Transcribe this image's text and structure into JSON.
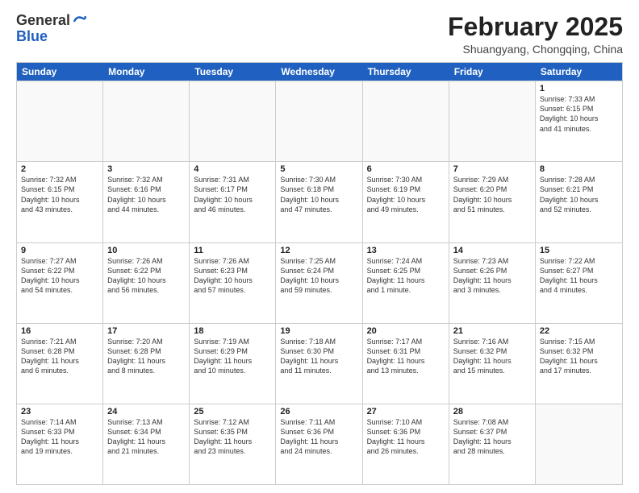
{
  "header": {
    "logo_general": "General",
    "logo_blue": "Blue",
    "month_title": "February 2025",
    "location": "Shuangyang, Chongqing, China"
  },
  "weekdays": [
    "Sunday",
    "Monday",
    "Tuesday",
    "Wednesday",
    "Thursday",
    "Friday",
    "Saturday"
  ],
  "weeks": [
    [
      {
        "day": "",
        "info": ""
      },
      {
        "day": "",
        "info": ""
      },
      {
        "day": "",
        "info": ""
      },
      {
        "day": "",
        "info": ""
      },
      {
        "day": "",
        "info": ""
      },
      {
        "day": "",
        "info": ""
      },
      {
        "day": "1",
        "info": "Sunrise: 7:33 AM\nSunset: 6:15 PM\nDaylight: 10 hours\nand 41 minutes."
      }
    ],
    [
      {
        "day": "2",
        "info": "Sunrise: 7:32 AM\nSunset: 6:15 PM\nDaylight: 10 hours\nand 43 minutes."
      },
      {
        "day": "3",
        "info": "Sunrise: 7:32 AM\nSunset: 6:16 PM\nDaylight: 10 hours\nand 44 minutes."
      },
      {
        "day": "4",
        "info": "Sunrise: 7:31 AM\nSunset: 6:17 PM\nDaylight: 10 hours\nand 46 minutes."
      },
      {
        "day": "5",
        "info": "Sunrise: 7:30 AM\nSunset: 6:18 PM\nDaylight: 10 hours\nand 47 minutes."
      },
      {
        "day": "6",
        "info": "Sunrise: 7:30 AM\nSunset: 6:19 PM\nDaylight: 10 hours\nand 49 minutes."
      },
      {
        "day": "7",
        "info": "Sunrise: 7:29 AM\nSunset: 6:20 PM\nDaylight: 10 hours\nand 51 minutes."
      },
      {
        "day": "8",
        "info": "Sunrise: 7:28 AM\nSunset: 6:21 PM\nDaylight: 10 hours\nand 52 minutes."
      }
    ],
    [
      {
        "day": "9",
        "info": "Sunrise: 7:27 AM\nSunset: 6:22 PM\nDaylight: 10 hours\nand 54 minutes."
      },
      {
        "day": "10",
        "info": "Sunrise: 7:26 AM\nSunset: 6:22 PM\nDaylight: 10 hours\nand 56 minutes."
      },
      {
        "day": "11",
        "info": "Sunrise: 7:26 AM\nSunset: 6:23 PM\nDaylight: 10 hours\nand 57 minutes."
      },
      {
        "day": "12",
        "info": "Sunrise: 7:25 AM\nSunset: 6:24 PM\nDaylight: 10 hours\nand 59 minutes."
      },
      {
        "day": "13",
        "info": "Sunrise: 7:24 AM\nSunset: 6:25 PM\nDaylight: 11 hours\nand 1 minute."
      },
      {
        "day": "14",
        "info": "Sunrise: 7:23 AM\nSunset: 6:26 PM\nDaylight: 11 hours\nand 3 minutes."
      },
      {
        "day": "15",
        "info": "Sunrise: 7:22 AM\nSunset: 6:27 PM\nDaylight: 11 hours\nand 4 minutes."
      }
    ],
    [
      {
        "day": "16",
        "info": "Sunrise: 7:21 AM\nSunset: 6:28 PM\nDaylight: 11 hours\nand 6 minutes."
      },
      {
        "day": "17",
        "info": "Sunrise: 7:20 AM\nSunset: 6:28 PM\nDaylight: 11 hours\nand 8 minutes."
      },
      {
        "day": "18",
        "info": "Sunrise: 7:19 AM\nSunset: 6:29 PM\nDaylight: 11 hours\nand 10 minutes."
      },
      {
        "day": "19",
        "info": "Sunrise: 7:18 AM\nSunset: 6:30 PM\nDaylight: 11 hours\nand 11 minutes."
      },
      {
        "day": "20",
        "info": "Sunrise: 7:17 AM\nSunset: 6:31 PM\nDaylight: 11 hours\nand 13 minutes."
      },
      {
        "day": "21",
        "info": "Sunrise: 7:16 AM\nSunset: 6:32 PM\nDaylight: 11 hours\nand 15 minutes."
      },
      {
        "day": "22",
        "info": "Sunrise: 7:15 AM\nSunset: 6:32 PM\nDaylight: 11 hours\nand 17 minutes."
      }
    ],
    [
      {
        "day": "23",
        "info": "Sunrise: 7:14 AM\nSunset: 6:33 PM\nDaylight: 11 hours\nand 19 minutes."
      },
      {
        "day": "24",
        "info": "Sunrise: 7:13 AM\nSunset: 6:34 PM\nDaylight: 11 hours\nand 21 minutes."
      },
      {
        "day": "25",
        "info": "Sunrise: 7:12 AM\nSunset: 6:35 PM\nDaylight: 11 hours\nand 23 minutes."
      },
      {
        "day": "26",
        "info": "Sunrise: 7:11 AM\nSunset: 6:36 PM\nDaylight: 11 hours\nand 24 minutes."
      },
      {
        "day": "27",
        "info": "Sunrise: 7:10 AM\nSunset: 6:36 PM\nDaylight: 11 hours\nand 26 minutes."
      },
      {
        "day": "28",
        "info": "Sunrise: 7:08 AM\nSunset: 6:37 PM\nDaylight: 11 hours\nand 28 minutes."
      },
      {
        "day": "",
        "info": ""
      }
    ]
  ]
}
